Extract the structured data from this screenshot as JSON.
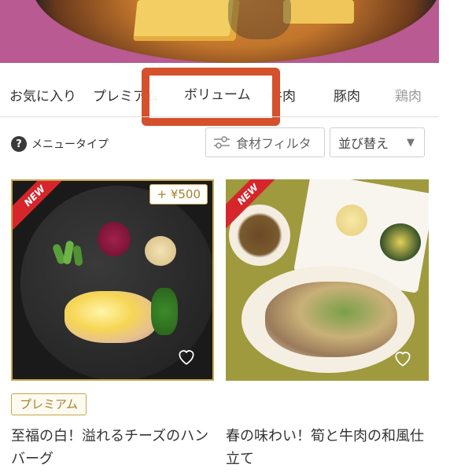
{
  "tabs": [
    {
      "label": "お気に入り"
    },
    {
      "label": "プレミアム"
    },
    {
      "label": "ボリューム"
    },
    {
      "label": "牛肉"
    },
    {
      "label": "豚肉"
    },
    {
      "label": "鶏肉"
    }
  ],
  "active_tab": "ボリューム",
  "toolbar": {
    "help_glyph": "?",
    "menu_type_label": "メニュータイプ",
    "ingredient_filter_label": "食材フィルタ",
    "sort_label": "並び替え",
    "sort_caret": "▼"
  },
  "cards": [
    {
      "new_label": "NEW",
      "price_badge": "+ ¥500",
      "tag": "プレミアム",
      "title": "至福の白！溢れるチーズのハンバーグ"
    },
    {
      "new_label": "NEW",
      "title": "春の味わい！筍と牛肉の和風仕立て"
    }
  ],
  "colors": {
    "highlight_border": "#d5502c",
    "gold_accent": "#c9a44a",
    "new_ribbon": "#d6262b"
  }
}
